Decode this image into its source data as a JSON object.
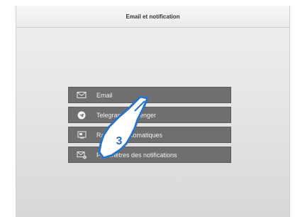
{
  "header": {
    "title": "Email et notification"
  },
  "menu": {
    "items": [
      {
        "label": "Email",
        "icon": "envelope-icon"
      },
      {
        "label": "Telegram Messenger",
        "icon": "telegram-icon"
      },
      {
        "label": "Rapports automatiques",
        "icon": "report-icon"
      },
      {
        "label": "Paramètres des notifications",
        "icon": "envelope-settings-icon"
      }
    ]
  },
  "overlay": {
    "step_number": "3"
  },
  "colors": {
    "menu_bg": "#6f6f6f",
    "hand_accent": "#2a73c8"
  }
}
